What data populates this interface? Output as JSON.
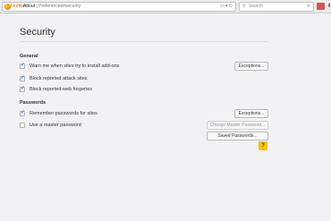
{
  "toolbar": {
    "brand": "Firefox",
    "url_host": "About",
    "url_path": "Preferences#security",
    "search_placeholder": "Search"
  },
  "page": {
    "title": "Security"
  },
  "general": {
    "heading": "General",
    "items": [
      {
        "label": "Warn me when sites try to install add-ons",
        "checked": true
      },
      {
        "label": "Block reported attack sites",
        "checked": true
      },
      {
        "label": "Block reported web forgeries",
        "checked": true
      }
    ],
    "exceptions_label": "Exceptions..."
  },
  "passwords": {
    "heading": "Passwords",
    "items": [
      {
        "label": "Remember passwords for sites",
        "checked": true
      },
      {
        "label": "Use a master password",
        "checked": false
      }
    ],
    "exceptions_label": "Exceptions...",
    "change_master_label": "Change Master Password...",
    "saved_passwords_label": "Saved Passwords..."
  },
  "help_label": "?"
}
